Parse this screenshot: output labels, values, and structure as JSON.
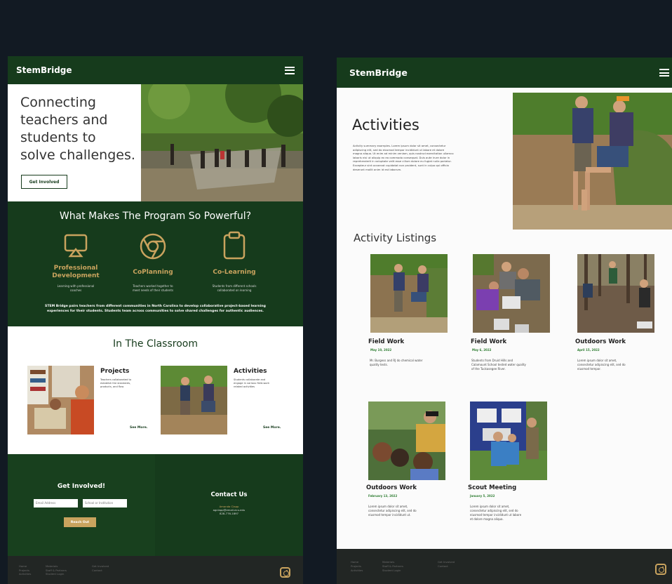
{
  "left": {
    "brand": "StemBridge",
    "hero": {
      "title_lines": [
        "Connecting",
        "teachers and",
        "students to",
        "solve challenges."
      ],
      "cta": "Get Involved"
    },
    "powerful": {
      "heading": "What Makes The Program So Powerful?",
      "features": [
        {
          "icon": "airplay-icon",
          "title_lines": [
            "Professional",
            "Development"
          ],
          "desc_lines": [
            "Learning with professional",
            "coaches"
          ]
        },
        {
          "icon": "chrome-circle-icon",
          "title_lines": [
            "CoPlanning"
          ],
          "desc_lines": [
            "Teachers worked together to",
            "meet needs of their students"
          ]
        },
        {
          "icon": "clipboard-icon",
          "title_lines": [
            "Co-Learning"
          ],
          "desc_lines": [
            "Students from different schools",
            "collaborated on learning"
          ]
        }
      ],
      "summary_lines": [
        "STEM Bridge pairs teachers from different communities in North Carolina to develop collaborative project-based learning",
        "experiences for their students. Students team across communities to solve shared challenges for authentic audiences."
      ]
    },
    "classroom": {
      "heading": "In The Classroom",
      "cards": [
        {
          "title": "Projects",
          "desc_lines": [
            "Teachers collaborated to",
            "establish the standards,",
            "products, and flow"
          ],
          "link": "See More."
        },
        {
          "title": "Activities",
          "desc_lines": [
            "Students collaborate and",
            "engage in various field-work",
            "related activities"
          ],
          "link": "See More."
        }
      ]
    },
    "get_involved": {
      "heading": "Get Involved!",
      "email_placeholder": "Email Address",
      "school_placeholder": "School or Institution",
      "button": "Reach Out"
    },
    "contact": {
      "heading": "Contact Us",
      "name": "Amanda Clapp",
      "email": "agclapp@email.ecu.edu",
      "phone": "828-776-1897"
    },
    "footer": {
      "columns": [
        [
          "Home",
          "Projects",
          "Activities"
        ],
        [
          "Materials",
          "Staff & Partners",
          "Student Login"
        ],
        [
          "Get Involved",
          "Contact"
        ]
      ]
    }
  },
  "right": {
    "brand": "StemBridge",
    "activities": {
      "heading": "Activities",
      "summary_lines": [
        "Activity summary examples. Lorem ipsum dolor sit amet, consectetur",
        "adipiscing elit, sed do eiusmod tempor incididunt ut labore et dolore",
        "magna aliqua. Ut enim ad minim veniam, quis nostrud exercitation ullamco",
        "laboris nisi ut aliquip ex ea commodo consequat. Duis aute irure dolor in",
        "reprehenderit in voluptate velit esse cillum dolore eu fugiat nulla pariatur.",
        "Excepteur sint occaecat cupidatat non proident, sunt in culpa qui officia",
        "deserunt mollit anim id est laborum."
      ]
    },
    "listings_heading": "Activity Listings",
    "listings": [
      {
        "title": "Field Work",
        "date": "May 10, 2022",
        "desc_lines": [
          "Mr. Burgess and RJ do chemical water",
          "quality tests."
        ]
      },
      {
        "title": "Field Work",
        "date": "May 6, 2022",
        "desc_lines": [
          "Students from Druid Hills and",
          "Calamount School tested water quality",
          "of the Tuckasegee River."
        ]
      },
      {
        "title": "Outdoors Work",
        "date": "April 15, 2022",
        "desc_lines": [
          "Lorem ipsum dolor sit amet,",
          "consectetur adipiscing elit, sed do",
          "eiusmod tempor."
        ]
      },
      {
        "title": "Outdoors Work",
        "date": "February 13, 2022",
        "desc_lines": [
          "Lorem ipsum dolor sit amet,",
          "consectetur adipiscing elit, sed do",
          "eiusmod tempor incididunt ut."
        ]
      },
      {
        "title": "Scout Meeting",
        "date": "January 5, 2022",
        "desc_lines": [
          "Lorem ipsum dolor sit amet,",
          "consectetur adipiscing elit, sed do",
          "eiusmod tempor incididunt ut labore",
          "et dolore magna aliqua."
        ]
      }
    ],
    "footer": {
      "columns": [
        [
          "Home",
          "Projects",
          "Activities"
        ],
        [
          "Materials",
          "Staff & Partners",
          "Student Login"
        ],
        [
          "Get Involved",
          "Contact"
        ]
      ]
    }
  },
  "colors": {
    "dark_green": "#163b1c",
    "gold": "#c9a35e",
    "page_bg": "#121a23",
    "date_green": "#2e7d32"
  }
}
